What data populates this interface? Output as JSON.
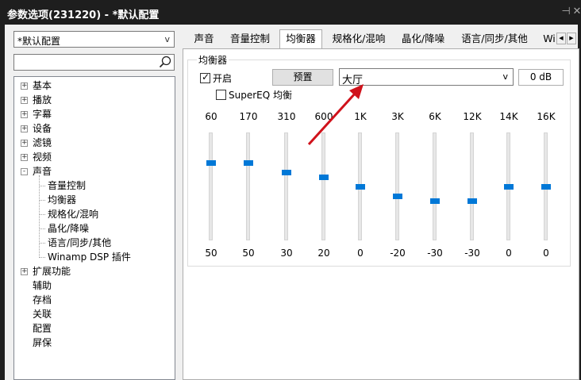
{
  "window": {
    "title": "参数选项(231220) - *默认配置",
    "pin_icon": "pin-icon",
    "close_icon": "close-icon"
  },
  "sidebar": {
    "preset_value": "*默认配置",
    "search_placeholder": "",
    "tree": [
      {
        "label": "基本",
        "expander": "+"
      },
      {
        "label": "播放",
        "expander": "+"
      },
      {
        "label": "字幕",
        "expander": "+"
      },
      {
        "label": "设备",
        "expander": "+"
      },
      {
        "label": "滤镜",
        "expander": "+"
      },
      {
        "label": "视频",
        "expander": "+"
      },
      {
        "label": "声音",
        "expander": "-"
      },
      {
        "label": "音量控制",
        "child": true
      },
      {
        "label": "均衡器",
        "child": true
      },
      {
        "label": "规格化/混响",
        "child": true
      },
      {
        "label": "晶化/降噪",
        "child": true
      },
      {
        "label": "语言/同步/其他",
        "child": true
      },
      {
        "label": "Winamp DSP 插件",
        "child": true
      },
      {
        "label": "扩展功能",
        "expander": "+"
      },
      {
        "label": "辅助"
      },
      {
        "label": "存档"
      },
      {
        "label": "关联"
      },
      {
        "label": "配置"
      },
      {
        "label": "屏保"
      }
    ]
  },
  "tabs": [
    {
      "label": "声音"
    },
    {
      "label": "音量控制"
    },
    {
      "label": "均衡器",
      "active": true
    },
    {
      "label": "规格化/混响"
    },
    {
      "label": "晶化/降噪"
    },
    {
      "label": "语言/同步/其他"
    },
    {
      "label": "Wi"
    }
  ],
  "tab_scroll": {
    "left": "◀",
    "right": "▶"
  },
  "equalizer": {
    "group_title": "均衡器",
    "enable_label": "开启",
    "enabled": true,
    "preset_button": "预置",
    "preset_selected": "大厅",
    "gain": "0 dB",
    "supereq_label": "SuperEQ 均衡",
    "supereq_enabled": false,
    "bands": [
      {
        "freq": "60",
        "value": 50
      },
      {
        "freq": "170",
        "value": 50
      },
      {
        "freq": "310",
        "value": 30
      },
      {
        "freq": "600",
        "value": 20
      },
      {
        "freq": "1K",
        "value": 0
      },
      {
        "freq": "3K",
        "value": -20
      },
      {
        "freq": "6K",
        "value": -30
      },
      {
        "freq": "12K",
        "value": -30
      },
      {
        "freq": "14K",
        "value": 0
      },
      {
        "freq": "16K",
        "value": 0
      }
    ]
  },
  "colors": {
    "accent": "#0078d7",
    "annotation_arrow": "#d0121b"
  }
}
